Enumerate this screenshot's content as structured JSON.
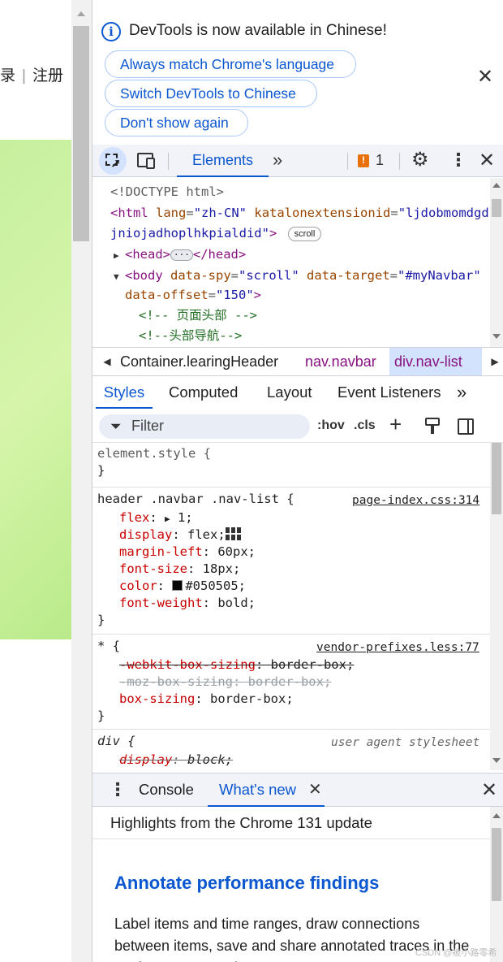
{
  "page": {
    "nav_login": "录",
    "nav_sep": "|",
    "nav_register": "注册"
  },
  "infobar": {
    "message": "DevTools is now available in Chinese!",
    "buttons": {
      "match_language": "Always match Chrome's language",
      "switch_chinese": "Switch DevTools to Chinese",
      "dont_show": "Don't show again"
    }
  },
  "toolbar": {
    "tab_elements": "Elements",
    "more_tabs": "»",
    "issues_count": "1"
  },
  "dom": {
    "doctype": "<!DOCTYPE html>",
    "html_open": "<html",
    "html_lang_attr": "lang",
    "html_lang_val": "\"zh-CN\"",
    "html_katalon_attr": "katalonextensionid",
    "html_katalon_val1": "\"ljdobmomdgdl",
    "html_katalon_val2": "jniojadhoplhkpialdid\"",
    "html_close": ">",
    "scroll_badge": "scroll",
    "head_open": "<head>",
    "head_close": "</head>",
    "head_ellipsis": "···",
    "body_open": "<body",
    "body_spy_attr": "data-spy",
    "body_spy_val": "\"scroll\"",
    "body_target_attr": "data-target",
    "body_target_val": "\"#myNavbar\"",
    "body_offset_attr": "data-offset",
    "body_offset_val": "\"150\"",
    "body_close": ">",
    "comment1": "<!-- 页面头部 -->",
    "comment2": "<!--头部导航-->"
  },
  "breadcrumb": {
    "items": [
      "Container.learingHeader",
      "nav.navbar",
      "div.nav-list"
    ]
  },
  "styles_tabs": {
    "styles": "Styles",
    "computed": "Computed",
    "layout": "Layout",
    "event_listeners": "Event Listeners",
    "more": "»"
  },
  "filter": {
    "placeholder": "Filter",
    "hov": ":hov",
    "cls": ".cls"
  },
  "rules": {
    "element_style": {
      "selector": "element.style {",
      "close": "}"
    },
    "navlist": {
      "selector": "header .navbar .nav-list {",
      "source": "page-index.css:314",
      "props": [
        {
          "name": "flex",
          "value": "1;"
        },
        {
          "name": "display",
          "value": "flex;"
        },
        {
          "name": "margin-left",
          "value": "60px;"
        },
        {
          "name": "font-size",
          "value": "18px;"
        },
        {
          "name": "color",
          "value": "#050505;"
        },
        {
          "name": "font-weight",
          "value": "bold;"
        }
      ],
      "close": "}"
    },
    "universal": {
      "selector": "* {",
      "source": "vendor-prefixes.less:77",
      "props": [
        {
          "name": "-webkit-box-sizing",
          "value": "border-box;"
        },
        {
          "name": "-moz-box-sizing",
          "value": "border-box;"
        },
        {
          "name": "box-sizing",
          "value": "border-box;"
        }
      ],
      "close": "}"
    },
    "div_ua": {
      "selector": "div {",
      "source": "user agent stylesheet",
      "props": [
        {
          "name": "display",
          "value": "block;"
        }
      ]
    }
  },
  "drawer": {
    "console": "Console",
    "whats_new": "What's new",
    "highlights": "Highlights from the Chrome 131 update",
    "title": "Annotate performance findings",
    "body": "Label items and time ranges, draw connections between items, save and share annotated traces in the Performance panel."
  },
  "watermark": "CSDN @被小路零希",
  "colors": {
    "accent": "#0b57d0",
    "tag": "#881280",
    "attr": "#994500",
    "value": "#1a1aa6",
    "comment": "#236e25",
    "css_prop": "#c80000",
    "issue": "#e8710a"
  }
}
